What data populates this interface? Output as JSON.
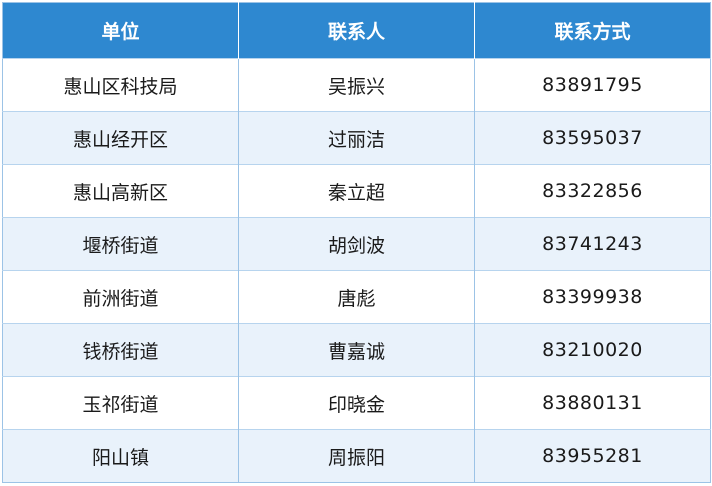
{
  "table": {
    "headers": [
      "单位",
      "联系人",
      "联系方式"
    ],
    "rows": [
      {
        "unit": "惠山区科技局",
        "contact": "吴振兴",
        "phone": "83891795"
      },
      {
        "unit": "惠山经开区",
        "contact": "过丽洁",
        "phone": "83595037"
      },
      {
        "unit": "惠山高新区",
        "contact": "秦立超",
        "phone": "83322856"
      },
      {
        "unit": "堰桥街道",
        "contact": "胡剑波",
        "phone": "83741243"
      },
      {
        "unit": "前洲街道",
        "contact": "唐彪",
        "phone": "83399938"
      },
      {
        "unit": "钱桥街道",
        "contact": "曹嘉诚",
        "phone": "83210020"
      },
      {
        "unit": "玉祁街道",
        "contact": "印晓金",
        "phone": "83880131"
      },
      {
        "unit": "阳山镇",
        "contact": "周振阳",
        "phone": "83955281"
      }
    ]
  },
  "colors": {
    "header_bg": "#2e88d0",
    "header_text": "#ffffff",
    "stripe_bg": "#e9f2fb",
    "border": "#9cc3e6"
  }
}
